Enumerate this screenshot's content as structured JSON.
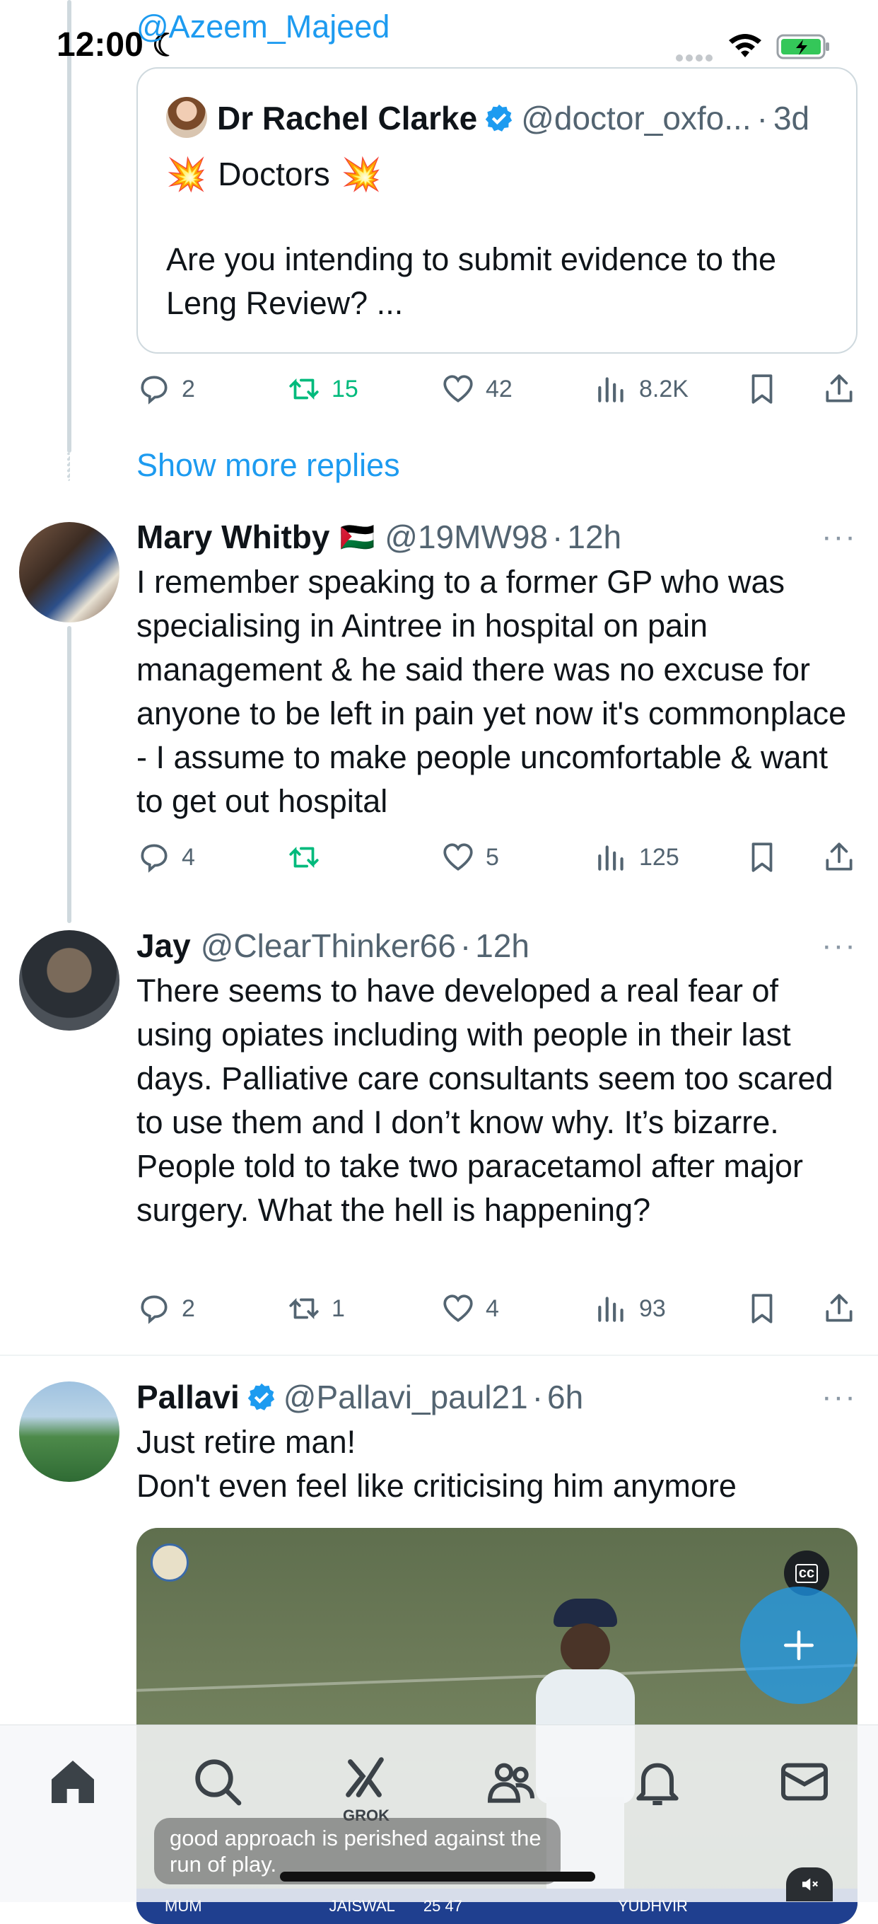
{
  "status_bar": {
    "time": "12:00"
  },
  "top_partial": {
    "handle": "@Azeem_Majeed"
  },
  "quote": {
    "name": "Dr Rachel Clarke",
    "handle": "@doctor_oxfo...",
    "dot": "·",
    "time": "3d",
    "line1_text": "Doctors",
    "emoji": "💥",
    "body": "Are you intending to submit evidence to the Leng Review? ..."
  },
  "tweet0_actions": {
    "replies": "2",
    "retweets": "15",
    "likes": "42",
    "views": "8.2K"
  },
  "show_more": "Show more replies",
  "tweets": [
    {
      "name": "Mary Whitby",
      "flag": "🇵🇸",
      "handle": "@19MW98",
      "dot": "·",
      "time": "12h",
      "more": "···",
      "text": "I remember speaking to a former GP who was specialising in Aintree in hospital on pain management & he said there was no excuse for anyone to be left in pain yet now it's commonplace - I assume to make people uncomfortable & want to get out hospital",
      "replies": "4",
      "retweets": "",
      "likes": "5",
      "views": "125"
    },
    {
      "name": "Jay",
      "handle": "@ClearThinker66",
      "dot": "·",
      "time": "12h",
      "more": "···",
      "text": "There seems to have developed a real fear of using opiates including with people in their last days. Palliative care consultants seem too scared to use them and I don’t know why. It’s bizarre. People told to take two paracetamol after major surgery. What the hell is happening?",
      "replies": "2",
      "retweets": "1",
      "likes": "4",
      "views": "93"
    },
    {
      "name": "Pallavi",
      "handle": "@Pallavi_paul21",
      "dot": "·",
      "time": "6h",
      "more": "···",
      "text_line1": "Just retire man!",
      "text_line2": "Don't even feel like criticising him anymore"
    }
  ],
  "video": {
    "cc_label": "cc",
    "caption": "good approach is perished against the run of play.",
    "score_left": "MUM",
    "score_jaiswal": "JAISWAL",
    "score_num": "25 47",
    "score_right": "YUDHVIR"
  },
  "tabbar": {
    "grok_label": "GROK"
  },
  "colors": {
    "accent": "#1d9bf0",
    "retweet": "#00ba7c",
    "text": "#0f1419",
    "secondary": "#536471"
  }
}
